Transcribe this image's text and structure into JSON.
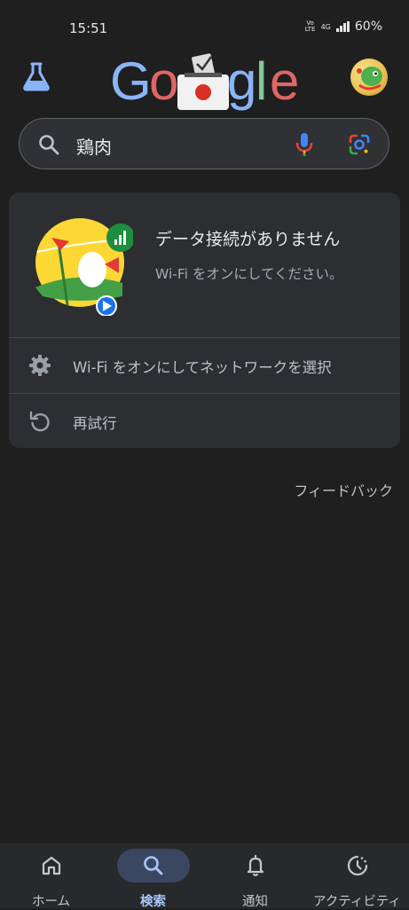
{
  "status_bar": {
    "time": "15:51",
    "volte": "Vo LTE",
    "network": "4G",
    "battery": "60%"
  },
  "search": {
    "query": "鶏肉"
  },
  "error_card": {
    "title": "データ接続がありません",
    "subtitle": "Wi-Fi をオンにしてください。",
    "actions": [
      {
        "label": "Wi-Fi をオンにしてネットワークを選択",
        "icon": "gear-icon"
      },
      {
        "label": "再試行",
        "icon": "retry-icon"
      }
    ]
  },
  "feedback_label": "フィードバック",
  "bottom_nav": {
    "items": [
      {
        "label": "ホーム",
        "icon": "home-icon",
        "active": false
      },
      {
        "label": "検索",
        "icon": "search-icon",
        "active": true
      },
      {
        "label": "通知",
        "icon": "bell-icon",
        "active": false
      },
      {
        "label": "アクティビティ",
        "icon": "activity-icon",
        "active": false
      }
    ]
  },
  "colors": {
    "background": "#1f1f1f",
    "card": "#2d2e31",
    "accent": "#a8c7fa",
    "nav_pill": "#3b4761"
  }
}
